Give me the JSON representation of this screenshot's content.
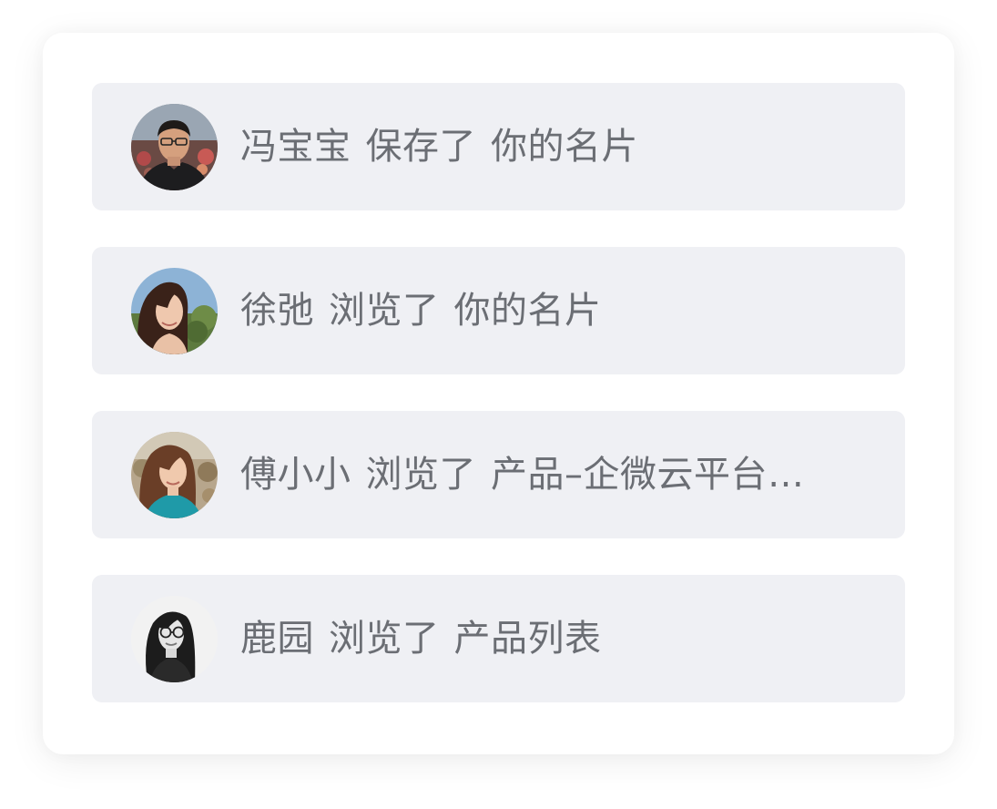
{
  "activity_feed": {
    "items": [
      {
        "name": "冯宝宝",
        "action": "保存了",
        "target": "你的名片",
        "avatar": "man-glasses-portrait"
      },
      {
        "name": "徐弛",
        "action": "浏览了",
        "target": "你的名片",
        "avatar": "woman-long-hair-portrait"
      },
      {
        "name": "傅小小",
        "action": "浏览了",
        "target": "产品–企微云平台…",
        "avatar": "woman-teal-top-portrait"
      },
      {
        "name": "鹿园",
        "action": "浏览了",
        "target": "产品列表",
        "avatar": "woman-glasses-bw-portrait"
      }
    ]
  },
  "colors": {
    "row_background": "#eff0f4",
    "text": "#6b6e74",
    "card": "#ffffff"
  }
}
